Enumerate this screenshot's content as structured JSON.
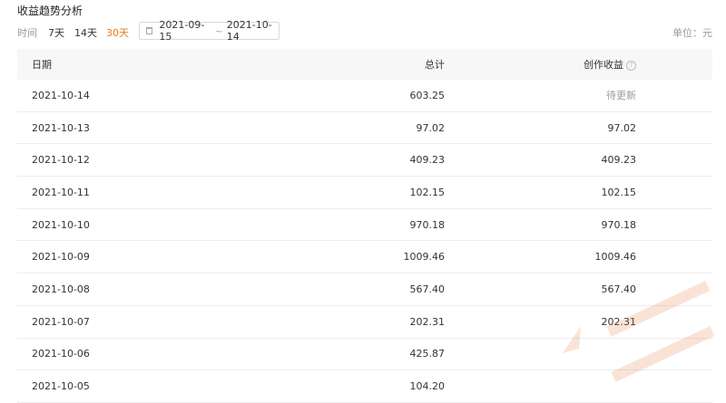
{
  "page_title": "收益趋势分析",
  "toolbar": {
    "time_label": "时间",
    "ranges": [
      "7天",
      "14天",
      "30天"
    ],
    "active_range": "30天",
    "date_start": "2021-09-15",
    "date_sep": "~",
    "date_end": "2021-10-14",
    "unit_label": "单位：元"
  },
  "table": {
    "headers": [
      "日期",
      "总计",
      "创作收益"
    ],
    "rows": [
      {
        "date": "2021-10-14",
        "total": "603.25",
        "earn": "待更新",
        "pending": true
      },
      {
        "date": "2021-10-13",
        "total": "97.02",
        "earn": "97.02"
      },
      {
        "date": "2021-10-12",
        "total": "409.23",
        "earn": "409.23"
      },
      {
        "date": "2021-10-11",
        "total": "102.15",
        "earn": "102.15"
      },
      {
        "date": "2021-10-10",
        "total": "970.18",
        "earn": "970.18"
      },
      {
        "date": "2021-10-09",
        "total": "1009.46",
        "earn": "1009.46"
      },
      {
        "date": "2021-10-08",
        "total": "567.40",
        "earn": "567.40"
      },
      {
        "date": "2021-10-07",
        "total": "202.31",
        "earn": "202.31"
      },
      {
        "date": "2021-10-06",
        "total": "425.87",
        "earn": ""
      },
      {
        "date": "2021-10-05",
        "total": "104.20",
        "earn": ""
      }
    ]
  },
  "colors": {
    "accent": "#e67e22",
    "header_bg": "#f7f7f7",
    "muted": "#999999"
  },
  "icons": {
    "date": "calendar-icon",
    "help": "help-icon"
  }
}
